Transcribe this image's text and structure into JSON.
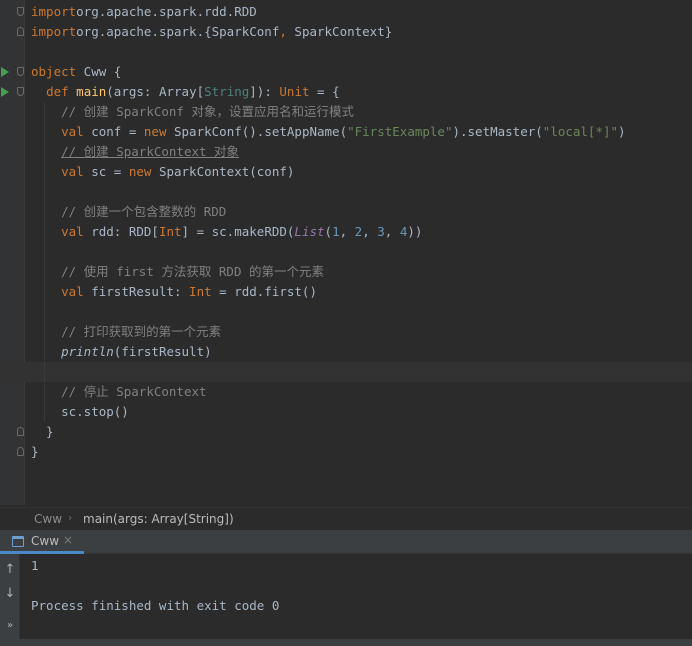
{
  "editor": {
    "lines": [
      {
        "segs": [
          [
            "kw",
            "import"
          ],
          [
            "",
            "org.apache.spark.rdd.RDD"
          ]
        ]
      },
      {
        "segs": [
          [
            "kw",
            "import"
          ],
          [
            "",
            "org.apache.spark.{SparkConf"
          ],
          [
            "kw",
            ","
          ],
          [
            "",
            " SparkContext}"
          ]
        ]
      },
      {
        "segs": []
      },
      {
        "segs": [
          [
            "kw",
            "object"
          ],
          [
            "",
            " Cww {"
          ]
        ]
      },
      {
        "segs": [
          [
            "",
            "  "
          ],
          [
            "kw",
            "def"
          ],
          [
            "",
            " "
          ],
          [
            "fn",
            "main"
          ],
          [
            "",
            "(args: Array["
          ],
          [
            "ty",
            "String"
          ],
          [
            "",
            "]): "
          ],
          [
            "kw",
            "Unit"
          ],
          [
            "",
            " = {"
          ]
        ]
      },
      {
        "segs": [
          [
            "",
            "    "
          ],
          [
            "cmt",
            "// 创建 SparkConf 对象，设置应用名和运行模式"
          ]
        ]
      },
      {
        "segs": [
          [
            "",
            "    "
          ],
          [
            "kw",
            "val"
          ],
          [
            "",
            " conf = "
          ],
          [
            "kw",
            "new"
          ],
          [
            "",
            " SparkConf().setAppName("
          ],
          [
            "str",
            "\"FirstExample\""
          ],
          [
            "",
            ").setMaster("
          ],
          [
            "str",
            "\"local[*]\""
          ],
          [
            "",
            ")"
          ]
        ]
      },
      {
        "segs": [
          [
            "",
            "    "
          ],
          [
            "cmt ul",
            "// 创建 SparkContext 对象"
          ]
        ]
      },
      {
        "segs": [
          [
            "",
            "    "
          ],
          [
            "kw",
            "val"
          ],
          [
            "",
            " sc = "
          ],
          [
            "kw",
            "new"
          ],
          [
            "",
            " SparkContext(conf)"
          ]
        ]
      },
      {
        "segs": []
      },
      {
        "segs": [
          [
            "",
            "    "
          ],
          [
            "cmt",
            "// 创建一个包含整数的 RDD"
          ]
        ]
      },
      {
        "segs": [
          [
            "",
            "    "
          ],
          [
            "kw",
            "val"
          ],
          [
            "",
            " rdd: RDD["
          ],
          [
            "kw",
            "Int"
          ],
          [
            "",
            "] = sc.makeRDD("
          ],
          [
            "it",
            "List"
          ],
          [
            "",
            "("
          ],
          [
            "num",
            "1"
          ],
          [
            "",
            ", "
          ],
          [
            "num",
            "2"
          ],
          [
            "",
            ", "
          ],
          [
            "num",
            "3"
          ],
          [
            "",
            ", "
          ],
          [
            "num",
            "4"
          ],
          [
            "",
            "))"
          ]
        ]
      },
      {
        "segs": []
      },
      {
        "segs": [
          [
            "",
            "    "
          ],
          [
            "cmt",
            "// 使用 first 方法获取 RDD 的第一个元素"
          ]
        ]
      },
      {
        "segs": [
          [
            "",
            "    "
          ],
          [
            "kw",
            "val"
          ],
          [
            "",
            " firstResult: "
          ],
          [
            "kw",
            "Int"
          ],
          [
            "",
            " = rdd.first()"
          ]
        ]
      },
      {
        "segs": []
      },
      {
        "segs": [
          [
            "",
            "    "
          ],
          [
            "cmt",
            "// 打印获取到的第一个元素"
          ]
        ]
      },
      {
        "segs": [
          [
            "",
            "    "
          ],
          [
            "itc",
            "println"
          ],
          [
            "",
            "(firstResult)"
          ]
        ]
      },
      {
        "segs": []
      },
      {
        "segs": [
          [
            "",
            "    "
          ],
          [
            "cmt",
            "// 停止 SparkContext"
          ]
        ]
      },
      {
        "segs": [
          [
            "",
            "    sc.stop()"
          ]
        ]
      },
      {
        "segs": [
          [
            "",
            "  }"
          ]
        ]
      },
      {
        "segs": [
          [
            "",
            "}"
          ]
        ]
      }
    ]
  },
  "breadcrumb": {
    "object": "Cww",
    "method": "main(args: Array[String])",
    "separator": "›"
  },
  "run": {
    "tab_label": "Cww",
    "tab_close": "×",
    "toolbar": {
      "up": "↑",
      "down": "↓",
      "more": "»"
    },
    "output_lines": [
      "1",
      "",
      "Process finished with exit code 0"
    ]
  }
}
